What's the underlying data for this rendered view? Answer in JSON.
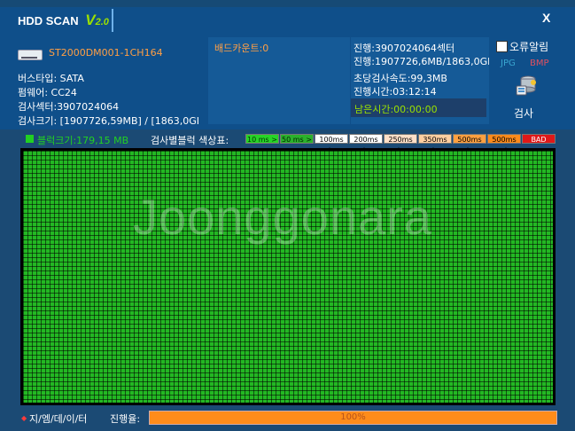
{
  "app": {
    "title": "HDD SCAN",
    "version_v": "V",
    "version_num": "2.0",
    "close": "X"
  },
  "drive": {
    "model": "ST2000DM001-1CH164",
    "bus": "버스타입: SATA",
    "firmware": "펌웨어: CC24",
    "sectors": "검사섹터:3907024064",
    "size": "검사크기: [1907726,59MB] / [1863,0GI"
  },
  "status": {
    "bad_count": "배드카운트:0",
    "progress_sectors": "진행:3907024064섹터",
    "progress_size": "진행:1907726,6MB/1863,0GE",
    "speed": "초당검사속도:99,3MB",
    "elapsed": "진행시간:03:12:14",
    "remaining": "남은시간:00:00:00"
  },
  "options": {
    "error_alarm": "오류알림",
    "error_alarm_checked": false,
    "jpg": "JPG",
    "bmp": "BMP",
    "scan_button": "검사"
  },
  "legend": {
    "block_size": "블럭크기:179,15 MB",
    "title": "검사별블럭 색상표:",
    "swatches": [
      {
        "label": "10 ms >",
        "bg": "#27d527",
        "fg": "#003300"
      },
      {
        "label": "50 ms >",
        "bg": "#2bb22b",
        "fg": "#002200"
      },
      {
        "label": "100ms >",
        "bg": "#ffffff",
        "fg": "#000000"
      },
      {
        "label": "200ms >",
        "bg": "#ffffff",
        "fg": "#000000"
      },
      {
        "label": "250ms >",
        "bg": "#ffe0c8",
        "fg": "#000000"
      },
      {
        "label": "350ms >",
        "bg": "#ffcfa0",
        "fg": "#000000"
      },
      {
        "label": "500ms >",
        "bg": "#ffa040",
        "fg": "#000000"
      },
      {
        "label": "500ms <",
        "bg": "#ff8a1a",
        "fg": "#000000"
      },
      {
        "label": "BAD",
        "bg": "#e01818",
        "fg": "#ffffff"
      }
    ]
  },
  "grid": {
    "watermark": "Joonggonara",
    "block_color": "#23b823"
  },
  "footer": {
    "brand": "지/엠/데/이/터",
    "progress_label": "진행율:",
    "progress_value": 100,
    "progress_text": "100%"
  }
}
